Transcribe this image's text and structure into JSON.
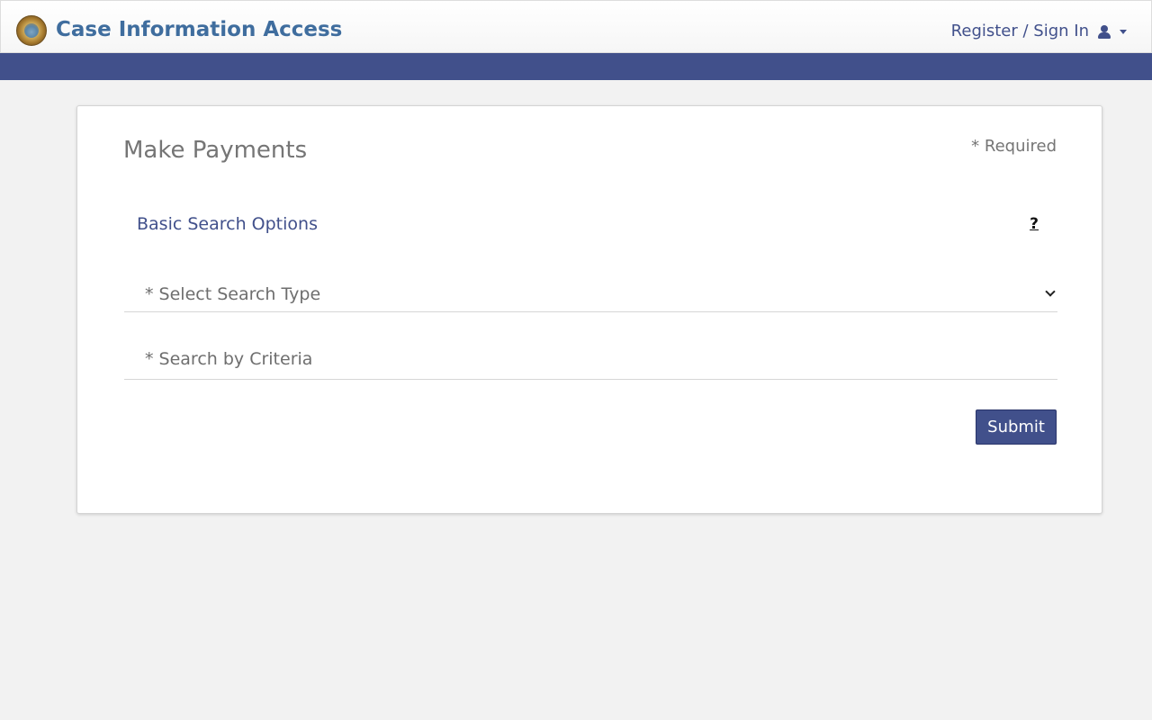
{
  "header": {
    "app_title": "Case Information Access",
    "signin_label": "Register / Sign In",
    "logo_icon": "court-seal-icon",
    "user_icon": "user-icon",
    "caret_icon": "caret-down-icon"
  },
  "colors": {
    "brand": "#41508b",
    "title_blue": "#3f6d9e",
    "background": "#f2f2f2"
  },
  "main": {
    "title": "Make Payments",
    "required_note": "* Required",
    "section_title": "Basic Search Options",
    "help_label": "?",
    "search_type": {
      "label": "* Select Search Type"
    },
    "criteria": {
      "label": "* Search by Criteria"
    },
    "submit_label": "Submit"
  }
}
